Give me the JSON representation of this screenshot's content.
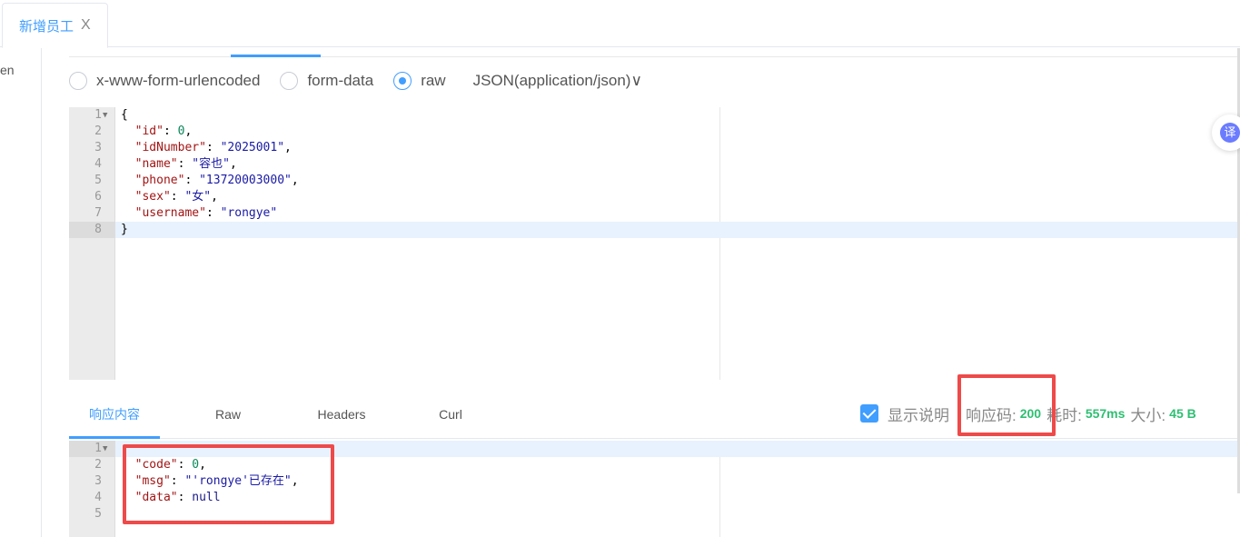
{
  "tabs": [
    {
      "label": "新增员工",
      "close": "X"
    }
  ],
  "left_panel": {
    "text": "en"
  },
  "body_types": {
    "options": [
      {
        "label": "x-www-form-urlencoded",
        "checked": false
      },
      {
        "label": "form-data",
        "checked": false
      },
      {
        "label": "raw",
        "checked": true
      }
    ],
    "content_type": "JSON(application/json)∨"
  },
  "request_body": {
    "lines": [
      "1",
      "2",
      "3",
      "4",
      "5",
      "6",
      "7",
      "8"
    ],
    "id_key": "\"id\"",
    "id_val": "0",
    "idNumber_key": "\"idNumber\"",
    "idNumber_val": "\"2025001\"",
    "name_key": "\"name\"",
    "name_val": "\"容也\"",
    "phone_key": "\"phone\"",
    "phone_val": "\"13720003000\"",
    "sex_key": "\"sex\"",
    "sex_val": "\"女\"",
    "username_key": "\"username\"",
    "username_val": "\"rongye\"",
    "open_brace": "{",
    "close_brace": "}"
  },
  "response_tabs": [
    "响应内容",
    "Raw",
    "Headers",
    "Curl"
  ],
  "response_meta": {
    "show_desc": "显示说明",
    "code_label": "响应码:",
    "code_value": "200",
    "time_label": "耗时:",
    "time_value": "557ms",
    "size_label": "大小:",
    "size_value": "45 B"
  },
  "response_body": {
    "lines": [
      "1",
      "2",
      "3",
      "4",
      "5"
    ],
    "code_key": "\"code\"",
    "code_val": "0",
    "msg_key": "\"msg\"",
    "msg_val": "\"'rongye'已存在\"",
    "data_key": "\"data\"",
    "data_val": "null"
  },
  "float_button": {
    "label": "译"
  },
  "colors": {
    "accent": "#409eff",
    "success": "#2dbf72",
    "highlight": "#ee4a4a"
  }
}
